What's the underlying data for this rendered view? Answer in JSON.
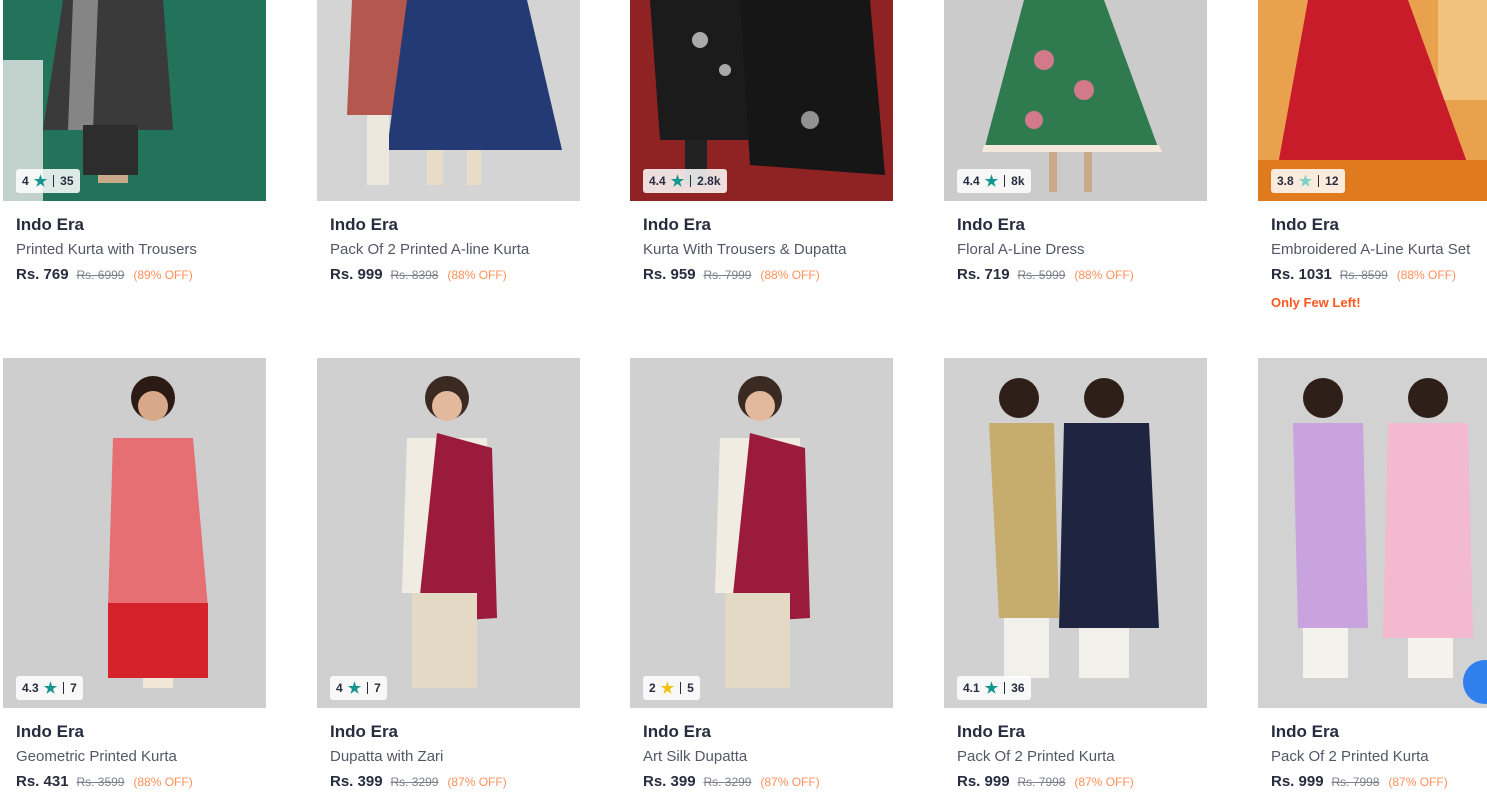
{
  "colors": {
    "star_teal": "#14958f",
    "star_gold": "#f2c210",
    "discount": "#ff905a",
    "few_left": "#ff5722"
  },
  "products": [
    {
      "brand": "Indo Era",
      "name": "Printed Kurta with Trousers",
      "price": "Rs. 769",
      "mrp": "Rs. 6999",
      "discount": "(89% OFF)",
      "rating": "4",
      "rating_count": "35",
      "star_icon": "teal-star-icon"
    },
    {
      "brand": "Indo Era",
      "name": "Pack Of 2 Printed A-line Kurta",
      "price": "Rs. 999",
      "mrp": "Rs. 8398",
      "discount": "(88% OFF)",
      "rating": "",
      "rating_count": ""
    },
    {
      "brand": "Indo Era",
      "name": "Kurta With Trousers & Dupatta",
      "price": "Rs. 959",
      "mrp": "Rs. 7999",
      "discount": "(88% OFF)",
      "rating": "4.4",
      "rating_count": "2.8k",
      "star_icon": "teal-star-icon"
    },
    {
      "brand": "Indo Era",
      "name": "Floral A-Line Dress",
      "price": "Rs. 719",
      "mrp": "Rs. 5999",
      "discount": "(88% OFF)",
      "rating": "4.4",
      "rating_count": "8k",
      "star_icon": "teal-star-icon"
    },
    {
      "brand": "Indo Era",
      "name": "Embroidered A-Line Kurta Set",
      "price": "Rs. 1031",
      "mrp": "Rs. 8599",
      "discount": "(88% OFF)",
      "rating": "3.8",
      "rating_count": "12",
      "star_icon": "light-teal-star-icon",
      "note": "Only Few Left!"
    },
    {
      "brand": "Indo Era",
      "name": "Geometric Printed Kurta",
      "price": "Rs. 431",
      "mrp": "Rs. 3599",
      "discount": "(88% OFF)",
      "rating": "4.3",
      "rating_count": "7",
      "star_icon": "teal-star-icon"
    },
    {
      "brand": "Indo Era",
      "name": "Dupatta with Zari",
      "price": "Rs. 399",
      "mrp": "Rs. 3299",
      "discount": "(87% OFF)",
      "rating": "4",
      "rating_count": "7",
      "star_icon": "teal-star-icon"
    },
    {
      "brand": "Indo Era",
      "name": "Art Silk Dupatta",
      "price": "Rs. 399",
      "mrp": "Rs. 3299",
      "discount": "(87% OFF)",
      "rating": "2",
      "rating_count": "5",
      "star_icon": "gold-star-icon"
    },
    {
      "brand": "Indo Era",
      "name": "Pack Of 2 Printed Kurta",
      "price": "Rs. 999",
      "mrp": "Rs. 7998",
      "discount": "(87% OFF)",
      "rating": "4.1",
      "rating_count": "36",
      "star_icon": "teal-star-icon"
    },
    {
      "brand": "Indo Era",
      "name": "Pack Of 2 Printed Kurta",
      "price": "Rs. 999",
      "mrp": "Rs. 7998",
      "discount": "(87% OFF)",
      "rating": "",
      "rating_count": ""
    }
  ]
}
